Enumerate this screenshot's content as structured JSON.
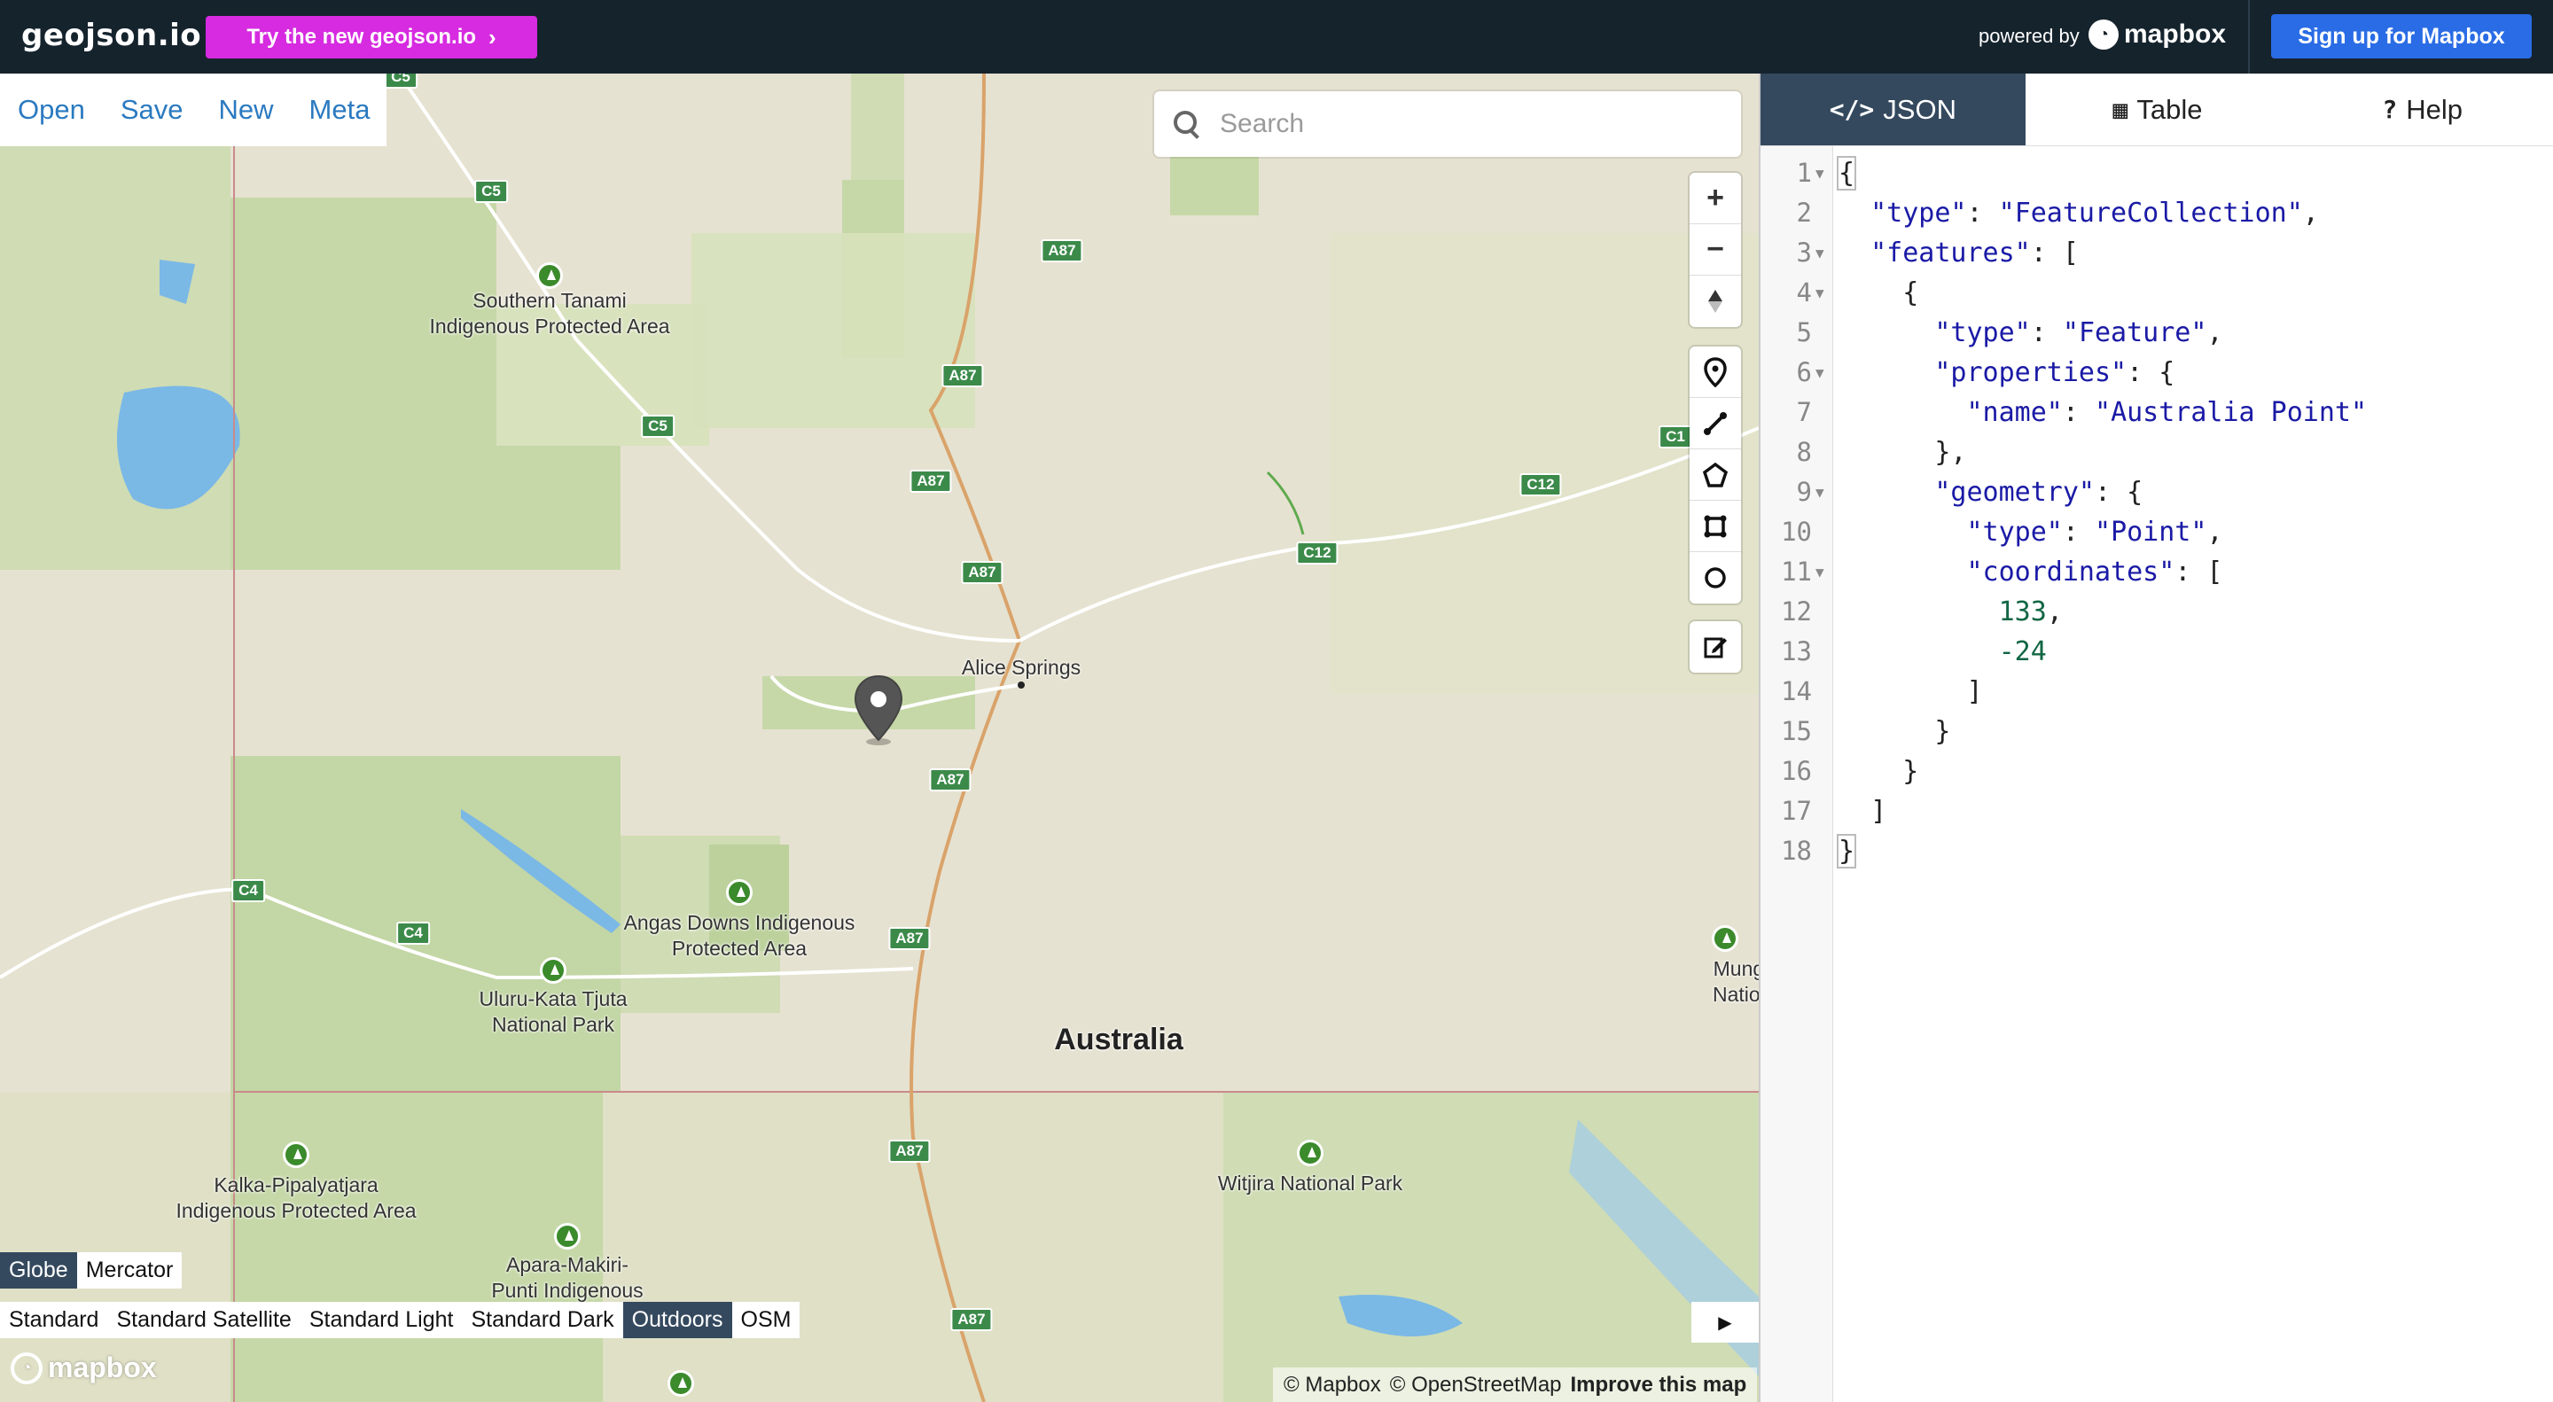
{
  "header": {
    "brand": "geojson.io",
    "try_new_label": "Try the new geojson.io",
    "powered_by": "powered by",
    "mapbox_logo_text": "mapbox",
    "signup_label": "Sign up for Mapbox"
  },
  "file_menu": [
    "Open",
    "Save",
    "New",
    "Meta"
  ],
  "search": {
    "placeholder": "Search"
  },
  "map_controls": {
    "zoom_in": "+",
    "zoom_out": "−"
  },
  "projections": {
    "options": [
      "Globe",
      "Mercator"
    ],
    "active": "Globe"
  },
  "map_styles": {
    "options": [
      "Standard",
      "Standard Satellite",
      "Standard Light",
      "Standard Dark",
      "Outdoors",
      "OSM"
    ],
    "active": "Outdoors"
  },
  "attribution": {
    "mapbox": "© Mapbox",
    "osm": "© OpenStreetMap",
    "improve": "Improve this map"
  },
  "watermark": "mapbox",
  "map_labels": {
    "southern_tanami": "Southern Tanami\nIndigenous Protected Area",
    "alice_springs": "Alice Springs",
    "angas_downs": "Angas Downs Indigenous\nProtected Area",
    "uluru": "Uluru-Kata Tjuta\nNational Park",
    "australia": "Australia",
    "kalka": "Kalka-Pipalyatjara\nIndigenous Protected Area",
    "witjira": "Witjira National Park",
    "apara": "Apara-Makiri-\nPunti Indigenous",
    "munga": "Munga-Th\nNational P"
  },
  "road_shields": [
    "C5",
    "C5",
    "A87",
    "A87",
    "C5",
    "A87",
    "A87",
    "C12",
    "C12",
    "C1",
    "A87",
    "C4",
    "C4",
    "A87",
    "A87",
    "A87"
  ],
  "panel": {
    "tabs": [
      {
        "icon": "</>",
        "label": "JSON"
      },
      {
        "icon": "▦",
        "label": "Table"
      },
      {
        "icon": "?",
        "label": "Help"
      }
    ],
    "active_tab": "JSON"
  },
  "geojson": {
    "type": "FeatureCollection",
    "feature_type": "Feature",
    "name": "Australia Point",
    "geometry_type": "Point",
    "coordinates": [
      133,
      -24
    ]
  },
  "colors": {
    "header_bg": "#15232d",
    "try_button": "#d62be0",
    "signup_button": "#2a6ce5",
    "active_tab": "#34495e",
    "link": "#2a7ac0",
    "json_key": "#1a1aa6",
    "json_number": "#116644"
  }
}
